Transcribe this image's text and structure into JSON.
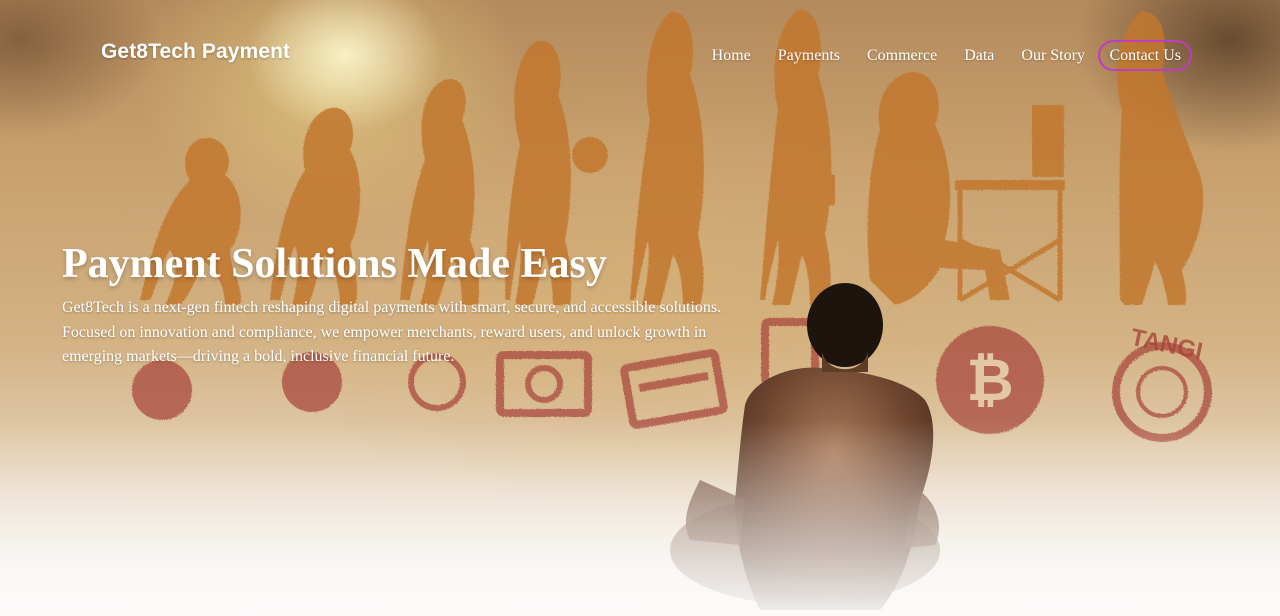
{
  "header": {
    "brand": "Get8Tech Payment",
    "nav": [
      {
        "label": "Home"
      },
      {
        "label": "Payments"
      },
      {
        "label": "Commerce"
      },
      {
        "label": "Data"
      },
      {
        "label": "Our Story"
      },
      {
        "label": "Contact Us"
      }
    ]
  },
  "hero": {
    "title": "Payment Solutions Made Easy",
    "description": "Get8Tech is a next-gen fintech reshaping digital payments with smart, secure, and accessible solutions. Focused on innovation and compliance, we empower merchants, reward users, and unlock growth in emerging markets—driving a bold, inclusive financial future.",
    "background_art": {
      "wall_text": "TANGI"
    }
  },
  "colors": {
    "contact_border": "#c03cc0",
    "text": "#ffffff",
    "wall_figures": "#c2772e",
    "wall_symbols": "#a8453a"
  }
}
